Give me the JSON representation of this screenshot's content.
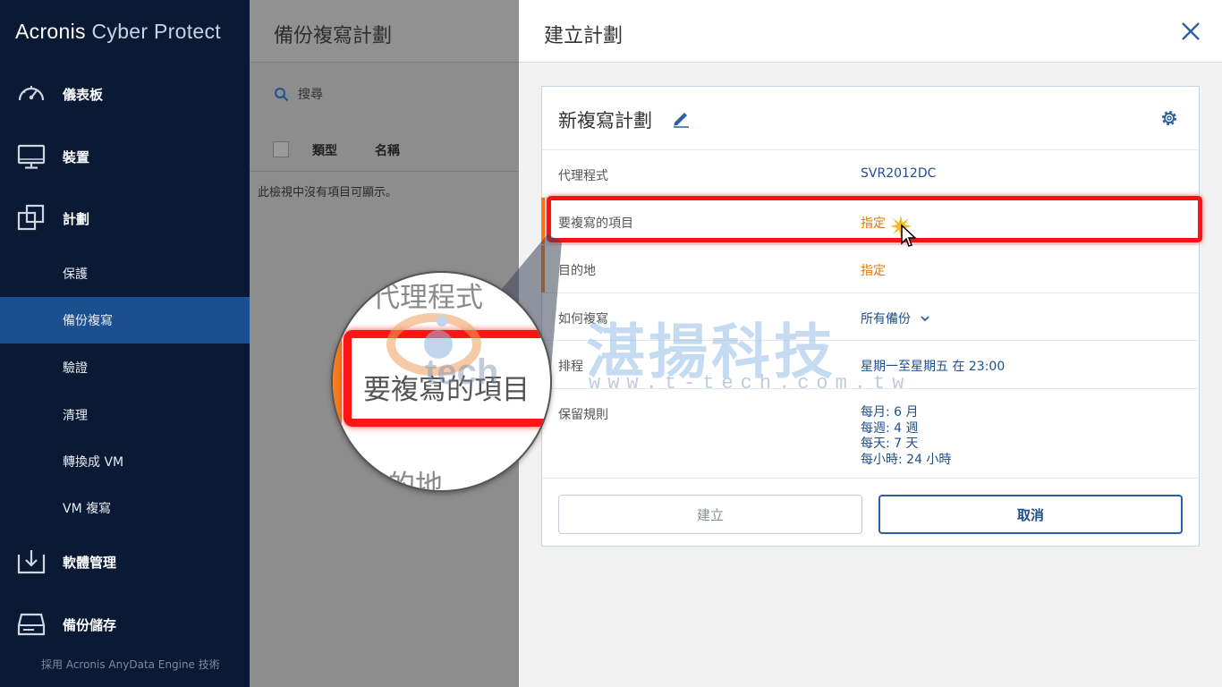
{
  "sidebar": {
    "brand_main": "Acronis",
    "brand_light": " Cyber Protect",
    "nav": [
      {
        "label": "儀表板",
        "icon": "dashboard-gauge-icon"
      },
      {
        "label": "裝置",
        "icon": "monitor-icon"
      },
      {
        "label": "計劃",
        "icon": "plans-copy-icon"
      }
    ],
    "sub": [
      {
        "label": "保護"
      },
      {
        "label": "備份複寫",
        "active": true
      },
      {
        "label": "驗證"
      },
      {
        "label": "清理"
      },
      {
        "label": "轉換成 VM"
      },
      {
        "label": "VM 複寫"
      }
    ],
    "nav_bottom": [
      {
        "label": "軟體管理",
        "icon": "download-tray-icon"
      },
      {
        "label": "備份儲存",
        "icon": "hard-drive-icon"
      }
    ],
    "footer": "採用 Acronis AnyData Engine 技術"
  },
  "middle": {
    "title": "備份複寫計劃",
    "search_label": "搜尋",
    "columns": [
      "類型",
      "名稱"
    ],
    "empty_message": "此檢視中沒有項目可顯示。"
  },
  "dialog": {
    "title": "建立計劃",
    "plan_name": "新複寫計劃",
    "rows": {
      "agent": {
        "key": "代理程式",
        "value": "SVR2012DC"
      },
      "items": {
        "key": "要複寫的項目",
        "value": "指定"
      },
      "destination": {
        "key": "目的地",
        "value": "指定"
      },
      "how": {
        "key": "如何複寫",
        "value": "所有備份"
      },
      "schedule": {
        "key": "排程",
        "value": "星期一至星期五 在 23:00"
      },
      "retention": {
        "key": "保留規則",
        "lines": [
          "每月: 6 月",
          "每週: 4 週",
          "每天: 7 天",
          "每小時: 24 小時"
        ]
      }
    },
    "create_button": "建立",
    "cancel_button": "取消"
  },
  "zoom": {
    "line1": "代理程式",
    "line2": "要複寫的項目",
    "line3": "目的地"
  },
  "watermark": {
    "brand": "tech",
    "chinese": "湛揚科技",
    "url": "www.t-tech.com.tw"
  },
  "colors": {
    "sidebar_bg": "#0a1a35",
    "active_nav": "#1b4f8f",
    "link_blue": "#1f4e8c",
    "orange": "#e07a0a",
    "highlight_red": "#ff1010"
  }
}
